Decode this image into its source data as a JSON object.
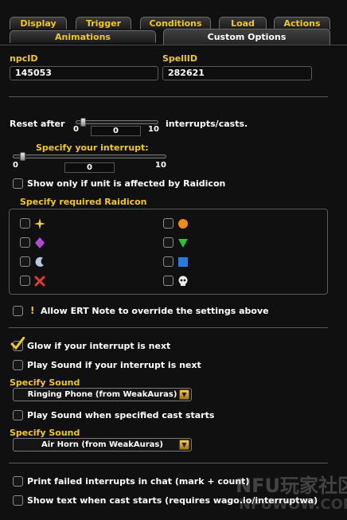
{
  "tabs_row1": [
    "Display",
    "Trigger",
    "Conditions",
    "Load",
    "Actions"
  ],
  "tabs_row2": [
    "Animations",
    "Custom Options"
  ],
  "active_tab": "Custom Options",
  "fields": {
    "npc_label": "npcID",
    "npc_value": "145053",
    "spell_label": "SpellID",
    "spell_value": "282621"
  },
  "reset": {
    "prefix": "Reset after",
    "suffix": "interrupts/casts.",
    "min": "0",
    "max": "10",
    "value": "0"
  },
  "interrupt": {
    "label": "Specify your interrupt:",
    "min": "0",
    "max": "10",
    "value": "0"
  },
  "raidicon": {
    "only_label": "Show only if unit is affected by Raidicon",
    "group_label": "Specify required Raidicon",
    "icons": [
      "star",
      "circle",
      "diamond",
      "triangle",
      "moon",
      "square",
      "cross",
      "skull"
    ]
  },
  "ert": {
    "warn_glyph": "!",
    "label": "Allow ERT Note to override the settings above"
  },
  "glow": {
    "label": "Glow if your interrupt is next",
    "checked": true
  },
  "play_sound_next": {
    "label": "Play Sound if your interrupt is next",
    "checked": false
  },
  "sound1": {
    "label": "Specify Sound",
    "value": "Ringing Phone (from WeakAuras)"
  },
  "play_sound_cast": {
    "label": "Play Sound when specified cast starts",
    "checked": false
  },
  "sound2": {
    "label": "Specify Sound",
    "value": "Air Horn (from WeakAuras)"
  },
  "print_failed": {
    "label": "Print failed interrupts in chat (mark + count)"
  },
  "show_text": {
    "label": "Show text when cast starts (requires wago.io/interruptwa)"
  },
  "watermark": {
    "cn": "NFU玩家社区",
    "url": "NFUWOW.COM"
  },
  "colors": {
    "accent": "#f2c81f",
    "text": "#ffffff",
    "background": "#101010"
  }
}
